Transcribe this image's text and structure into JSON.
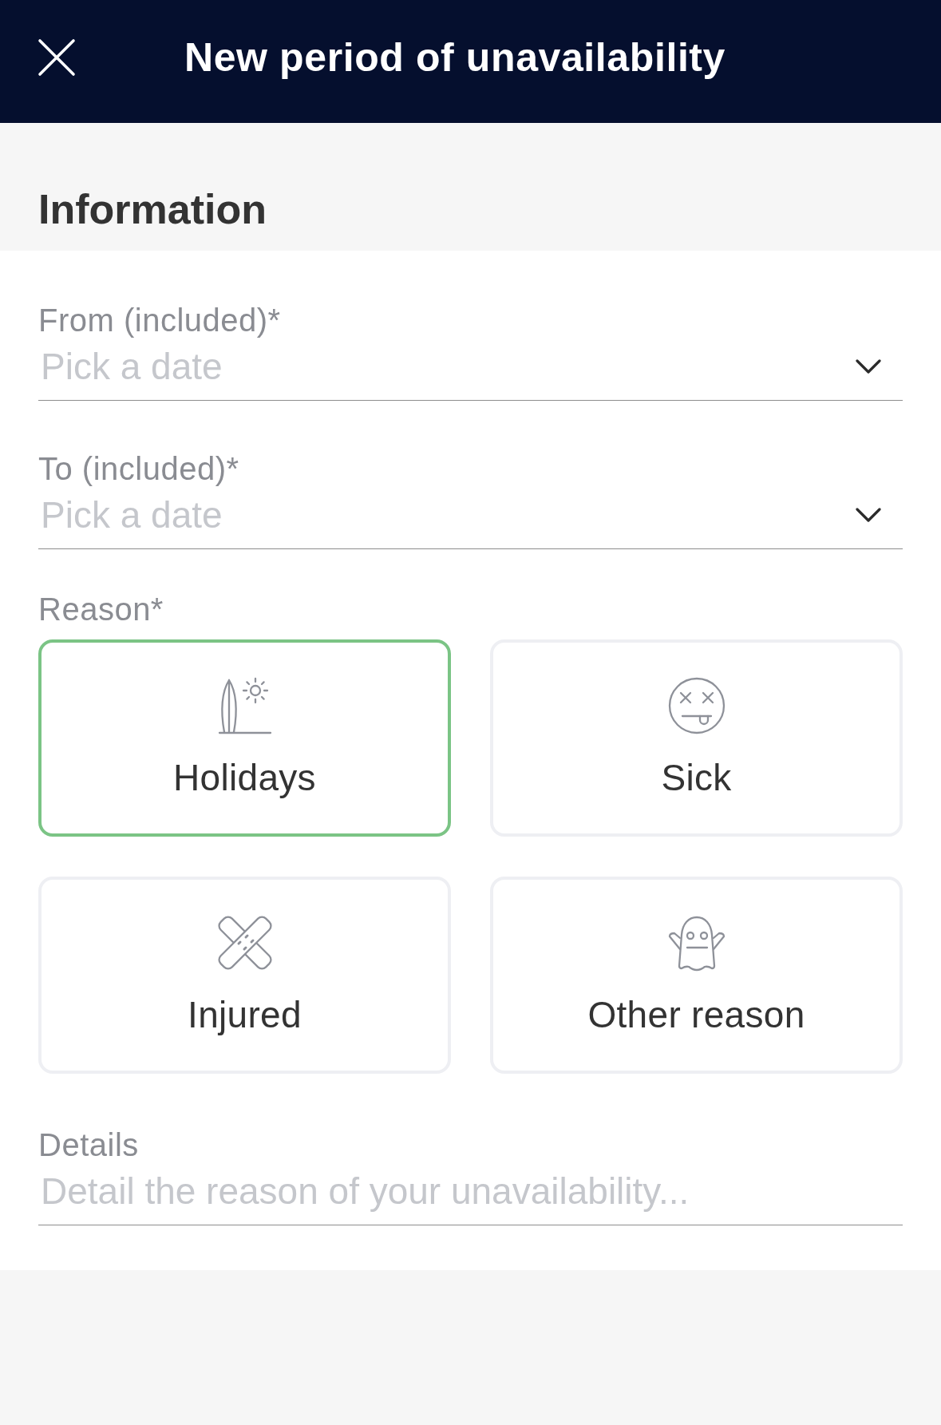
{
  "header": {
    "title": "New period of unavailability"
  },
  "section": {
    "title": "Information"
  },
  "date_fields": [
    {
      "label": "From (included)*",
      "placeholder": "Pick a date"
    },
    {
      "label": "To (included)*",
      "placeholder": "Pick a date"
    }
  ],
  "reason": {
    "label": "Reason*",
    "options": [
      {
        "kind": "holidays",
        "label": "Holidays",
        "selected": true
      },
      {
        "kind": "sick",
        "label": "Sick",
        "selected": false
      },
      {
        "kind": "injured",
        "label": "Injured",
        "selected": false
      },
      {
        "kind": "other",
        "label": "Other reason",
        "selected": false
      }
    ]
  },
  "details": {
    "label": "Details",
    "placeholder": "Detail the reason of your unavailability..."
  }
}
